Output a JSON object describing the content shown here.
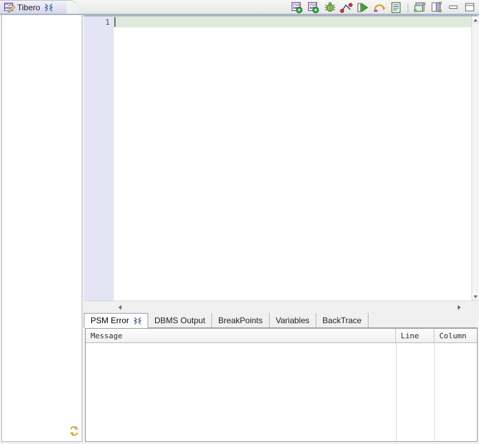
{
  "window": {
    "background_color": "#f3f3f1"
  },
  "editor_tab": {
    "label": "Tibero",
    "icon": "psm-file-icon",
    "doc_text": "PSM",
    "close_icon": "close-icon",
    "close_glyph": "╳"
  },
  "toolbar": {
    "buttons": [
      {
        "name": "compile-psm-button",
        "icon": "psm-compile-icon",
        "tooltip": "Compile PSM"
      },
      {
        "name": "compile-debug-psm-button",
        "icon": "psm-compile-debug-icon",
        "tooltip": "Compile for Debug"
      },
      {
        "name": "debug-button",
        "icon": "bug-icon",
        "tooltip": "Debug"
      },
      {
        "name": "toggle-breakpoint-button",
        "icon": "breakpoint-icon",
        "tooltip": "Toggle Breakpoint"
      },
      {
        "name": "run-button",
        "icon": "run-icon",
        "tooltip": "Run"
      },
      {
        "name": "step-return-button",
        "icon": "step-return-icon",
        "tooltip": "Step Return"
      },
      {
        "name": "show-output-button",
        "icon": "document-lines-icon",
        "tooltip": "Show Output"
      }
    ],
    "window_buttons": [
      {
        "name": "restore-view-button",
        "icon": "restore-view-icon"
      },
      {
        "name": "maximize-view-button",
        "icon": "maximize-view-icon"
      },
      {
        "name": "minimize-window-button",
        "icon": "minimize-icon"
      },
      {
        "name": "maximize-window-button",
        "icon": "maximize-icon"
      }
    ]
  },
  "left_panel": {
    "name": "navigator-panel",
    "sync_icon": "sync-arrows-icon",
    "content": ""
  },
  "editor": {
    "line_numbers": [
      "1"
    ],
    "content": "",
    "current_line_highlight": "#e0e9dd",
    "gutter_color": "#e4e4f4",
    "vertical_scrollbar": {
      "up_icon": "scroll-up-arrow-icon",
      "down_icon": "scroll-down-arrow-icon"
    },
    "horizontal_scrollbar": {
      "left_icon": "scroll-left-arrow-icon",
      "right_icon": "scroll-right-arrow-icon"
    }
  },
  "bottom_panel": {
    "tabs": [
      {
        "label": "PSM Error",
        "active": true,
        "closable": true,
        "close_glyph": "╳"
      },
      {
        "label": "DBMS Output",
        "active": false,
        "closable": false
      },
      {
        "label": "BreakPoints",
        "active": false,
        "closable": false
      },
      {
        "label": "Variables",
        "active": false,
        "closable": false
      },
      {
        "label": "BackTrace",
        "active": false,
        "closable": false
      }
    ],
    "table": {
      "columns": [
        "Message",
        "Line",
        "Column"
      ],
      "rows": []
    }
  }
}
